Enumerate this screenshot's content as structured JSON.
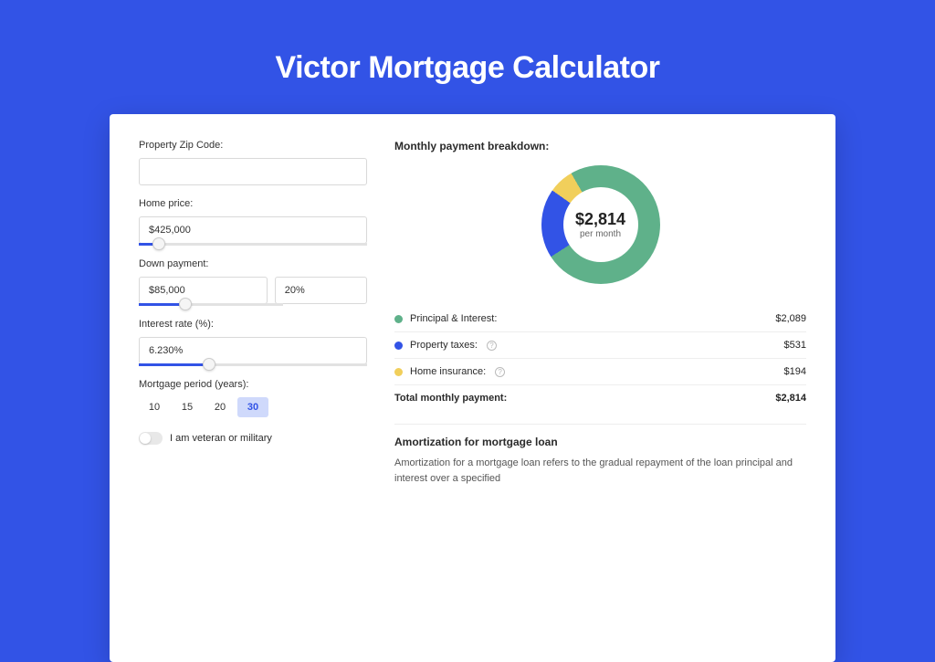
{
  "title": "Victor Mortgage Calculator",
  "form": {
    "zip_label": "Property Zip Code:",
    "zip_value": "",
    "home_price_label": "Home price:",
    "home_price_value": "$425,000",
    "down_payment_label": "Down payment:",
    "down_payment_value": "$85,000",
    "down_payment_pct": "20%",
    "interest_label": "Interest rate (%):",
    "interest_value": "6.230%",
    "period_label": "Mortgage period (years):",
    "period_options": [
      "10",
      "15",
      "20",
      "30"
    ],
    "period_selected": "30",
    "veteran_label": "I am veteran or military"
  },
  "breakdown": {
    "title": "Monthly payment breakdown:",
    "donut_amount": "$2,814",
    "donut_sub": "per month",
    "items": [
      {
        "label": "Principal & Interest:",
        "value": "$2,089",
        "color": "#5fb18a"
      },
      {
        "label": "Property taxes:",
        "value": "$531",
        "color": "#3253e6",
        "info": true
      },
      {
        "label": "Home insurance:",
        "value": "$194",
        "color": "#f1cf5b",
        "info": true
      }
    ],
    "total_label": "Total monthly payment:",
    "total_value": "$2,814"
  },
  "amortization": {
    "title": "Amortization for mortgage loan",
    "body": "Amortization for a mortgage loan refers to the gradual repayment of the loan principal and interest over a specified"
  },
  "colors": {
    "principal": "#5fb18a",
    "taxes": "#3253e6",
    "insurance": "#f1cf5b"
  },
  "chart_data": {
    "type": "pie",
    "title": "Monthly payment breakdown",
    "series": [
      {
        "name": "Principal & Interest",
        "value": 2089
      },
      {
        "name": "Property taxes",
        "value": 531
      },
      {
        "name": "Home insurance",
        "value": 194
      }
    ],
    "total": 2814,
    "unit": "USD per month"
  }
}
